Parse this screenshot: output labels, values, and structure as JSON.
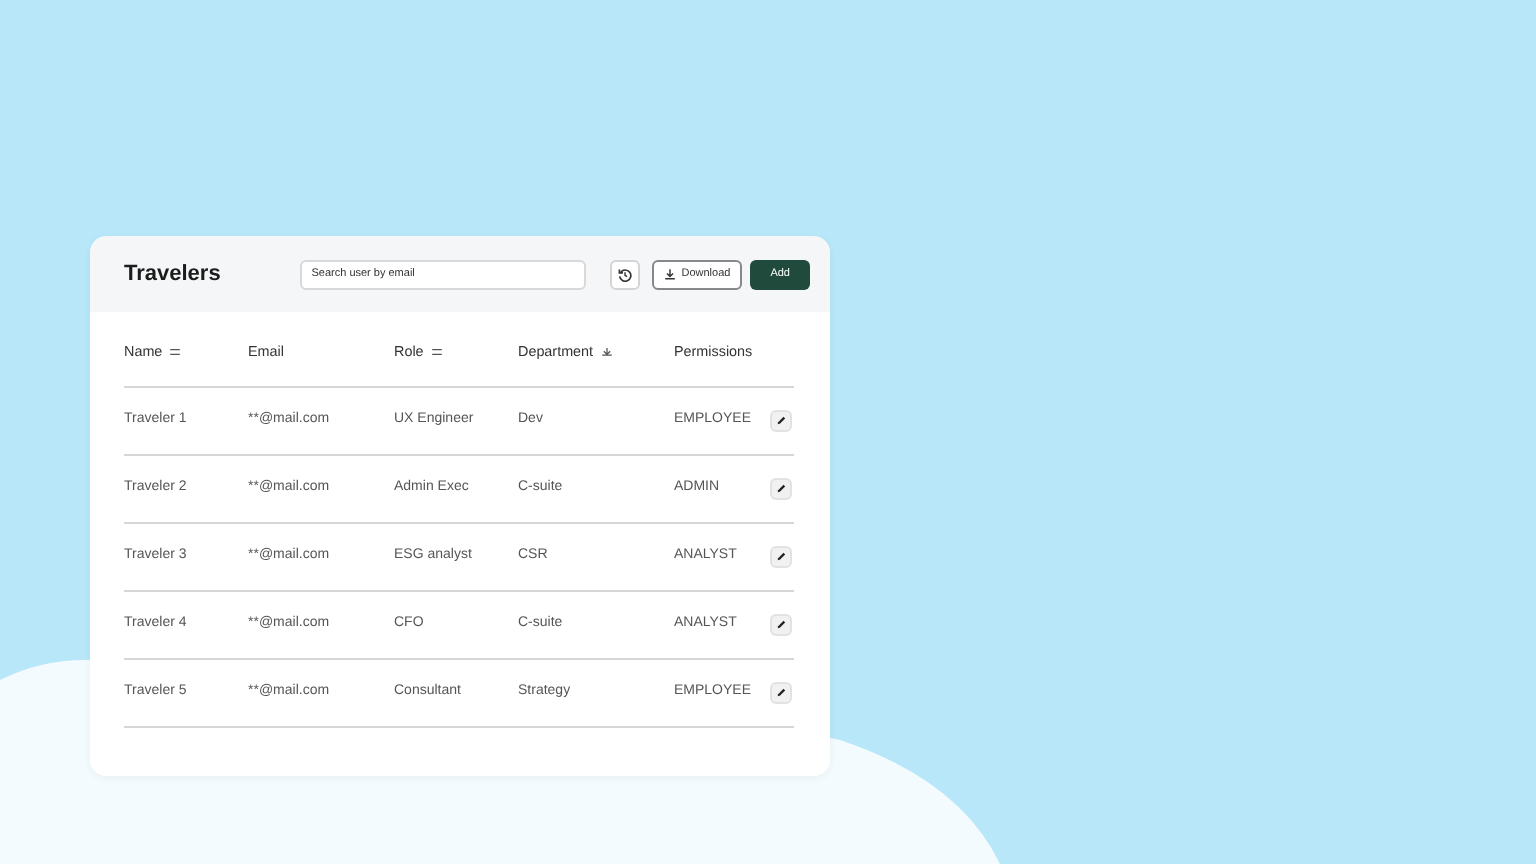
{
  "title": "Travelers",
  "search": {
    "placeholder": "Search user by email"
  },
  "buttons": [
    {
      "kind": "history"
    },
    {
      "kind": "download",
      "label": "Download"
    },
    {
      "kind": "add",
      "label": "Add"
    }
  ],
  "table": {
    "columns": [
      {
        "label": "Name",
        "kind": "sortable"
      },
      {
        "label": "Email",
        "kind": "plain"
      },
      {
        "label": "Role",
        "kind": "sortable"
      },
      {
        "label": "Department",
        "kind": "sorted"
      },
      {
        "label": "Permissions",
        "kind": "plain"
      }
    ],
    "rows": [
      {
        "cells": [
          "Traveler 1",
          "**@mail.com",
          "UX Engineer",
          "Dev",
          "EMPLOYEE"
        ]
      },
      {
        "cells": [
          "Traveler 2",
          "**@mail.com",
          "Admin Exec",
          "C-suite",
          "ADMIN"
        ]
      },
      {
        "cells": [
          "Traveler 3",
          "**@mail.com",
          "ESG analyst",
          "CSR",
          "ANALYST"
        ]
      },
      {
        "cells": [
          "Traveler 4",
          "**@mail.com",
          "CFO",
          "C-suite",
          "ANALYST"
        ]
      },
      {
        "cells": [
          "Traveler 5",
          "**@mail.com",
          "Consultant",
          "Strategy",
          "EMPLOYEE"
        ]
      }
    ]
  }
}
